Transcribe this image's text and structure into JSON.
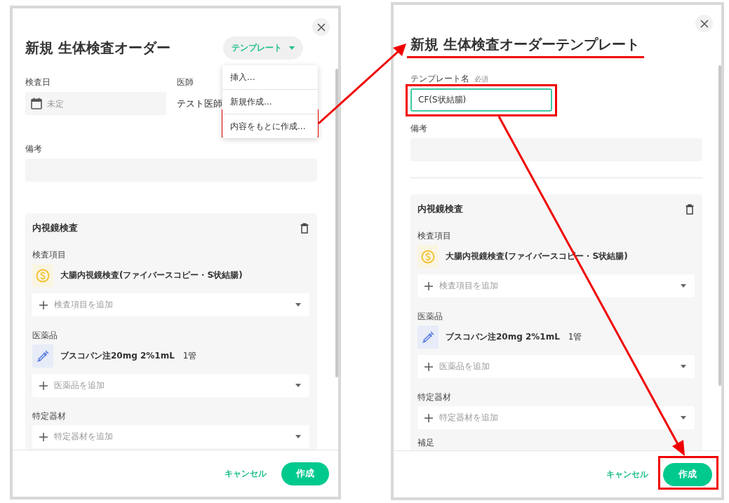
{
  "dialogs": [
    {
      "kind": "order",
      "title": "新規 生体検査オーダー",
      "template_button": "テンプレート",
      "template_menu": {
        "expanded": true,
        "items": [
          "挿入...",
          "新規作成...",
          "内容をもとに作成..."
        ]
      },
      "rows": [
        [
          {
            "kind": "date",
            "label": "検査日",
            "placeholder": "未定"
          },
          {
            "kind": "static",
            "label": "医師",
            "value": "テスト医師"
          }
        ],
        [
          {
            "kind": "memo",
            "label": "備考"
          }
        ]
      ],
      "divider": false,
      "section": {
        "title": "内視鏡検査",
        "groups": [
          {
            "label": "検査項目",
            "items": [
              {
                "kind": "exam",
                "name": "大腸内視鏡検査(ファイバースコピー・S状結腸)"
              }
            ],
            "add_placeholder": "検査項目を追加"
          },
          {
            "label": "医薬品",
            "items": [
              {
                "kind": "drug",
                "name": "ブスコパン注20mg 2%1mL",
                "quantity": "1管"
              }
            ],
            "add_placeholder": "医薬品を追加"
          },
          {
            "label": "特定器材",
            "add_placeholder": "特定器材を追加"
          }
        ]
      },
      "footer": {
        "cancel": "キャンセル",
        "submit": "作成"
      }
    },
    {
      "kind": "template",
      "title": "新規 生体検査オーダーテンプレート",
      "rows": [
        [
          {
            "kind": "text",
            "label": "テンプレート名",
            "required_note": "必須",
            "value": "CF(S状結腸)",
            "focused": true
          }
        ],
        [
          {
            "kind": "memo",
            "label": "備考"
          }
        ]
      ],
      "divider": true,
      "section": {
        "title": "内視鏡検査",
        "groups": [
          {
            "label": "検査項目",
            "items": [
              {
                "kind": "exam",
                "name": "大腸内視鏡検査(ファイバースコピー・S状結腸)"
              }
            ],
            "add_placeholder": "検査項目を追加"
          },
          {
            "label": "医薬品",
            "items": [
              {
                "kind": "drug",
                "name": "ブスコパン注20mg 2%1mL",
                "quantity": "1管"
              }
            ],
            "add_placeholder": "医薬品を追加"
          },
          {
            "label": "特定器材",
            "add_placeholder": "特定器材を追加"
          },
          {
            "label": "補足"
          }
        ]
      },
      "footer": {
        "cancel": "キャンセル",
        "submit": "作成"
      }
    }
  ]
}
